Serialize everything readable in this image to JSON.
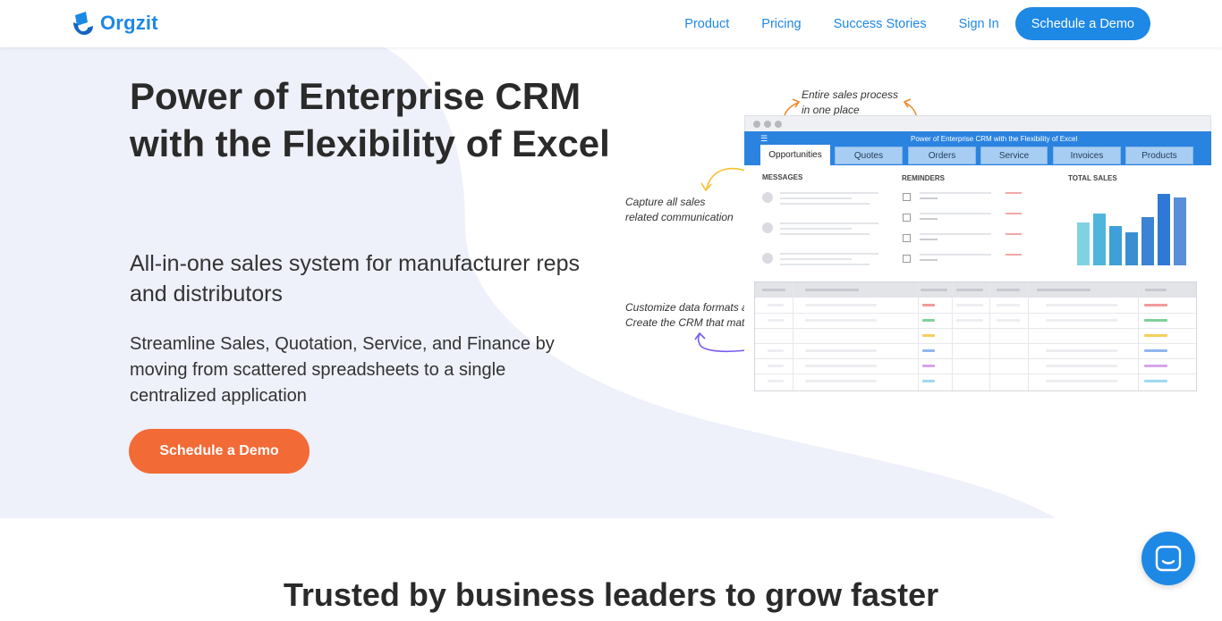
{
  "header": {
    "brand": "Orgzit",
    "nav": [
      {
        "label": "Product"
      },
      {
        "label": "Pricing"
      },
      {
        "label": "Success Stories"
      },
      {
        "label": "Sign In"
      }
    ],
    "cta_label": "Schedule a Demo"
  },
  "hero": {
    "title": "Power of Enterprise CRM with the Flexibility of Excel",
    "subtitle": "All-in-one sales system for manufacturer reps and distributors",
    "description": "Streamline Sales, Quotation, Service, and Finance by moving from scattered spreadsheets to a single centralized application",
    "cta_label": "Schedule a Demo"
  },
  "illustration": {
    "annotation_top": "Entire sales process\nin one place",
    "annotation_left": "Capture all sales\nrelated communication",
    "annotation_bottom": "Customize data formats and workflows\nCreate the CRM that matches your business",
    "app_title": "Power of Enterprise CRM with the Flexibility of Excel",
    "tabs": [
      {
        "label": "Opportunities"
      },
      {
        "label": "Quotes"
      },
      {
        "label": "Orders"
      },
      {
        "label": "Service"
      },
      {
        "label": "Invoices"
      },
      {
        "label": "Products"
      }
    ],
    "sections": {
      "messages": "MESSAGES",
      "reminders": "REMINDERS",
      "total_sales": "TOTAL SALES"
    }
  },
  "trusted": {
    "heading": "Trusted by business leaders to grow faster"
  },
  "colors": {
    "brand": "#1e88e5",
    "cta": "#f26a36",
    "hero_bg": "#f2f4fb"
  }
}
